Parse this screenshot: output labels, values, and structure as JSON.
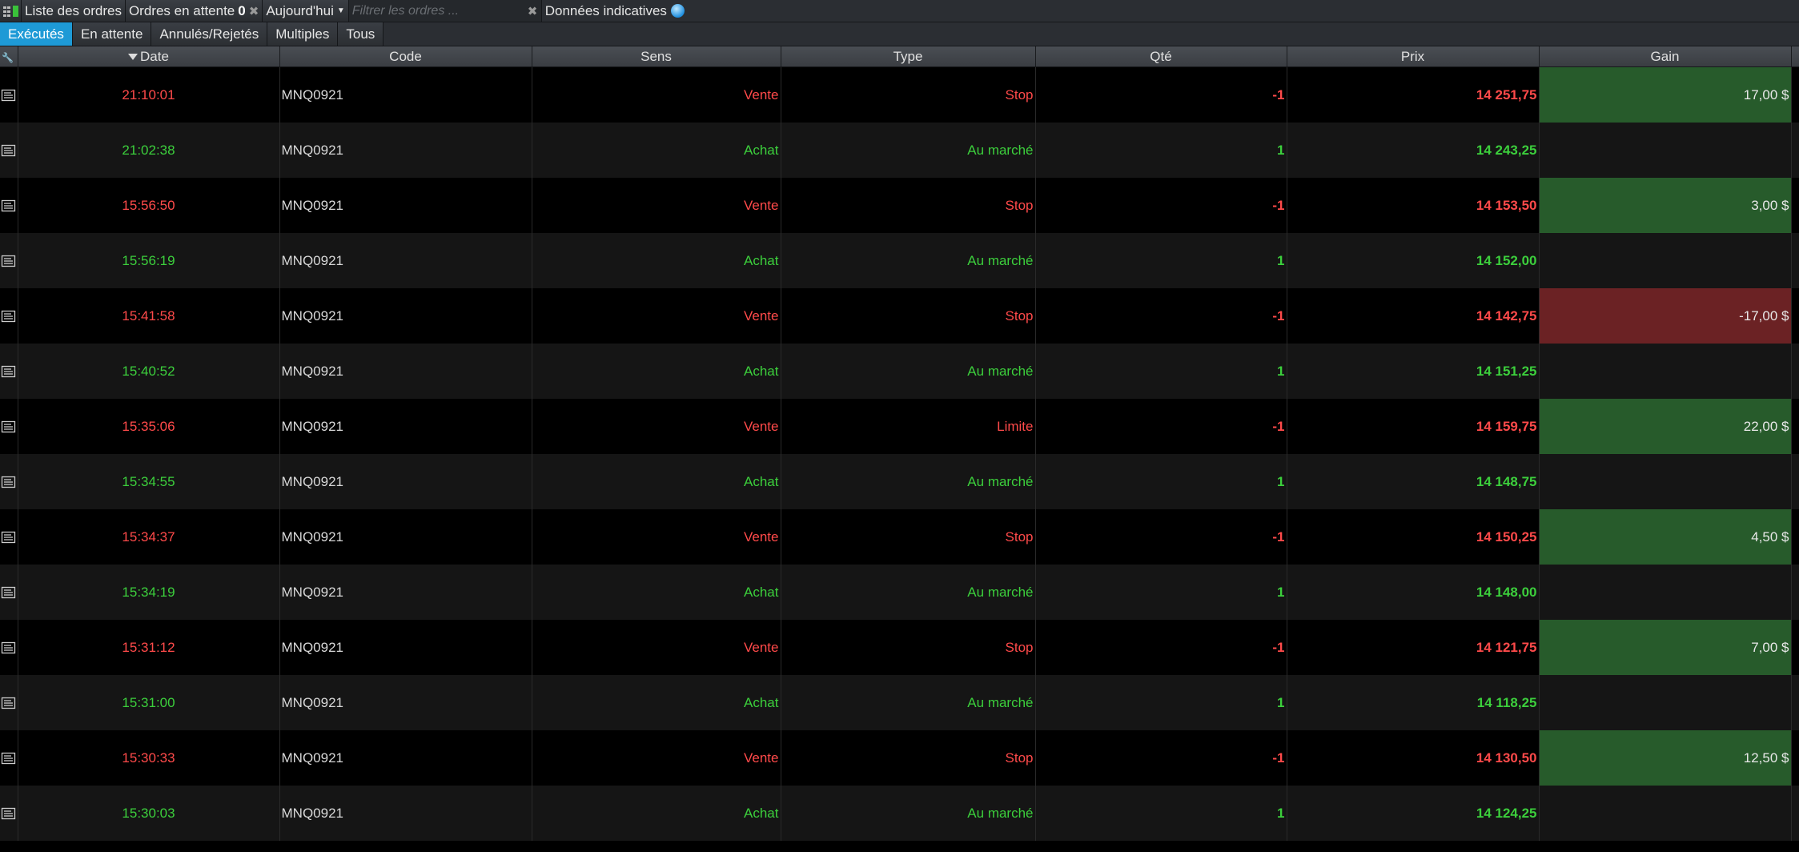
{
  "toolbar": {
    "title": "Liste des ordres",
    "pending_label": "Ordres en attente",
    "pending_count": "0",
    "date_filter": "Aujourd'hui",
    "filter_placeholder": "Filtrer les ordres ...",
    "indicative_label": "Données indicatives"
  },
  "tabs": [
    "Exécutés",
    "En attente",
    "Annulés/Rejetés",
    "Multiples",
    "Tous"
  ],
  "active_tab": 0,
  "columns": [
    "Date",
    "Code",
    "Sens",
    "Type",
    "Qté",
    "Prix",
    "Gain"
  ],
  "sort_column": "Date",
  "colors": {
    "sell": "#ff4a4a",
    "buy": "#3ccf3c",
    "gain_positive": "#275b2b",
    "gain_negative": "#6b2224",
    "active_tab": "#1e9ad6"
  },
  "rows": [
    {
      "date": "21:10:01",
      "code": "MNQ0921",
      "sens": "Vente",
      "type": "Stop",
      "qty": "-1",
      "price": "14 251,75",
      "gain": "17,00 $"
    },
    {
      "date": "21:02:38",
      "code": "MNQ0921",
      "sens": "Achat",
      "type": "Au marché",
      "qty": "1",
      "price": "14 243,25",
      "gain": ""
    },
    {
      "date": "15:56:50",
      "code": "MNQ0921",
      "sens": "Vente",
      "type": "Stop",
      "qty": "-1",
      "price": "14 153,50",
      "gain": "3,00 $"
    },
    {
      "date": "15:56:19",
      "code": "MNQ0921",
      "sens": "Achat",
      "type": "Au marché",
      "qty": "1",
      "price": "14 152,00",
      "gain": ""
    },
    {
      "date": "15:41:58",
      "code": "MNQ0921",
      "sens": "Vente",
      "type": "Stop",
      "qty": "-1",
      "price": "14 142,75",
      "gain": "-17,00 $"
    },
    {
      "date": "15:40:52",
      "code": "MNQ0921",
      "sens": "Achat",
      "type": "Au marché",
      "qty": "1",
      "price": "14 151,25",
      "gain": ""
    },
    {
      "date": "15:35:06",
      "code": "MNQ0921",
      "sens": "Vente",
      "type": "Limite",
      "qty": "-1",
      "price": "14 159,75",
      "gain": "22,00 $"
    },
    {
      "date": "15:34:55",
      "code": "MNQ0921",
      "sens": "Achat",
      "type": "Au marché",
      "qty": "1",
      "price": "14 148,75",
      "gain": ""
    },
    {
      "date": "15:34:37",
      "code": "MNQ0921",
      "sens": "Vente",
      "type": "Stop",
      "qty": "-1",
      "price": "14 150,25",
      "gain": "4,50 $"
    },
    {
      "date": "15:34:19",
      "code": "MNQ0921",
      "sens": "Achat",
      "type": "Au marché",
      "qty": "1",
      "price": "14 148,00",
      "gain": ""
    },
    {
      "date": "15:31:12",
      "code": "MNQ0921",
      "sens": "Vente",
      "type": "Stop",
      "qty": "-1",
      "price": "14 121,75",
      "gain": "7,00 $"
    },
    {
      "date": "15:31:00",
      "code": "MNQ0921",
      "sens": "Achat",
      "type": "Au marché",
      "qty": "1",
      "price": "14 118,25",
      "gain": ""
    },
    {
      "date": "15:30:33",
      "code": "MNQ0921",
      "sens": "Vente",
      "type": "Stop",
      "qty": "-1",
      "price": "14 130,50",
      "gain": "12,50 $"
    },
    {
      "date": "15:30:03",
      "code": "MNQ0921",
      "sens": "Achat",
      "type": "Au marché",
      "qty": "1",
      "price": "14 124,25",
      "gain": ""
    }
  ]
}
